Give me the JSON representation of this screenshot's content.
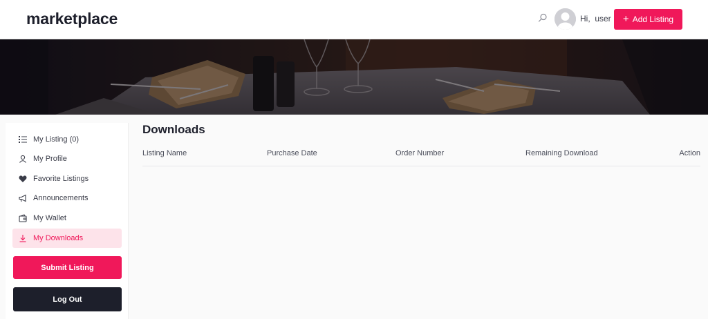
{
  "header": {
    "logo": "marketplace",
    "greeting": "Hi,  user",
    "add_listing_label": "Add Listing",
    "accent_color": "#f0185a"
  },
  "banner": {
    "image": "restaurant-table-banner"
  },
  "sidebar": {
    "items": [
      {
        "label": "My Listing (0)",
        "icon": "list-icon",
        "active": false
      },
      {
        "label": "My Profile",
        "icon": "user-icon",
        "active": false
      },
      {
        "label": "Favorite Listings",
        "icon": "heart-icon",
        "active": false
      },
      {
        "label": "Announcements",
        "icon": "megaphone-icon",
        "active": false
      },
      {
        "label": "My Wallet",
        "icon": "wallet-icon",
        "active": false
      },
      {
        "label": "My Downloads",
        "icon": "download-icon",
        "active": true
      }
    ],
    "submit_label": "Submit Listing",
    "logout_label": "Log Out"
  },
  "main": {
    "title": "Downloads",
    "columns": [
      "Listing Name",
      "Purchase Date",
      "Order Number",
      "Remaining Download",
      "Action"
    ],
    "rows": []
  }
}
